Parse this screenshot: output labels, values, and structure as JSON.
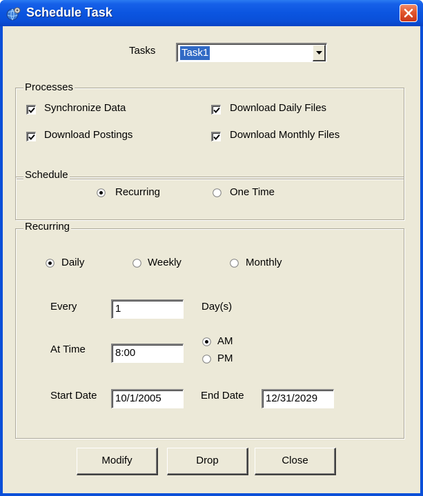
{
  "window": {
    "title": "Schedule Task",
    "icon": "globe-gear-icon",
    "close_icon": "close-icon"
  },
  "tasks": {
    "label": "Tasks",
    "value": "Task1"
  },
  "processes": {
    "legend": "Processes",
    "items": [
      {
        "label": "Synchronize Data",
        "checked": true
      },
      {
        "label": "Download Daily Files",
        "checked": true
      },
      {
        "label": "Download Postings",
        "checked": true
      },
      {
        "label": "Download Monthly Files",
        "checked": true
      }
    ]
  },
  "schedule": {
    "legend": "Schedule",
    "options": [
      {
        "label": "Recurring",
        "selected": true
      },
      {
        "label": "One Time",
        "selected": false
      }
    ]
  },
  "recurring": {
    "legend": "Recurring",
    "frequency": [
      {
        "label": "Daily",
        "selected": true
      },
      {
        "label": "Weekly",
        "selected": false
      },
      {
        "label": "Monthly",
        "selected": false
      }
    ],
    "every": {
      "label": "Every",
      "value": "1",
      "unit": "Day(s)"
    },
    "at_time": {
      "label": "At Time",
      "value": "8:00"
    },
    "ampm": [
      {
        "label": "AM",
        "selected": true
      },
      {
        "label": "PM",
        "selected": false
      }
    ],
    "start_date": {
      "label": "Start Date",
      "value": "10/1/2005"
    },
    "end_date": {
      "label": "End Date",
      "value": "12/31/2029"
    }
  },
  "buttons": {
    "modify": "Modify",
    "drop": "Drop",
    "close": "Close"
  },
  "colors": {
    "titlebar": "#0a4fd8",
    "dialog_bg": "#ece9d8",
    "selection": "#316ac5",
    "close_button": "#e2572e"
  }
}
